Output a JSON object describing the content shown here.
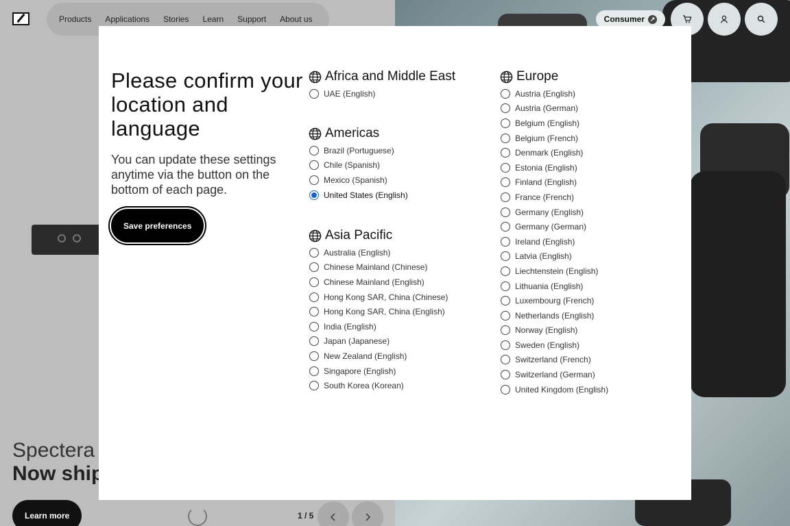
{
  "header": {
    "nav": [
      "Products",
      "Applications",
      "Stories",
      "Learn",
      "Support",
      "About us"
    ],
    "consumer_label": "Consumer"
  },
  "hero": {
    "title": "Spectera",
    "subtitle": "Now ship",
    "learn_more": "Learn more",
    "pager": "1 / 5"
  },
  "modal": {
    "title": "Please confirm your location and language",
    "description": "You can update these settings anytime via the button on the bottom of each page.",
    "save_label": "Save preferences",
    "selected": "United States (English)"
  },
  "regions": {
    "africa": {
      "name": "Africa and Middle East",
      "options": [
        "UAE (English)"
      ]
    },
    "americas": {
      "name": "Americas",
      "options": [
        "Brazil (Portuguese)",
        "Chile (Spanish)",
        "Mexico (Spanish)",
        "United States (English)"
      ]
    },
    "asia": {
      "name": "Asia Pacific",
      "options": [
        "Australia (English)",
        "Chinese Mainland (Chinese)",
        "Chinese Mainland (English)",
        "Hong Kong SAR, China (Chinese)",
        "Hong Kong SAR, China (English)",
        "India (English)",
        "Japan (Japanese)",
        "New Zealand (English)",
        "Singapore (English)",
        "South Korea (Korean)"
      ]
    },
    "europe": {
      "name": "Europe",
      "options": [
        "Austria (English)",
        "Austria (German)",
        "Belgium (English)",
        "Belgium (French)",
        "Denmark (English)",
        "Estonia (English)",
        "Finland (English)",
        "France (French)",
        "Germany (English)",
        "Germany (German)",
        "Ireland (English)",
        "Latvia (English)",
        "Liechtenstein (English)",
        "Lithuania (English)",
        "Luxembourg (French)",
        "Netherlands (English)",
        "Norway (English)",
        "Sweden (English)",
        "Switzerland (French)",
        "Switzerland (German)",
        "United Kingdom (English)"
      ]
    }
  },
  "colors": {
    "accent": "#1565c0",
    "button": "#000000"
  }
}
